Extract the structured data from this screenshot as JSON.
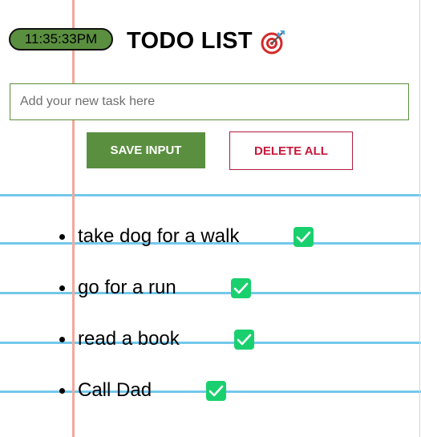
{
  "header": {
    "clock_time": "11:35:33PM",
    "title": "TODO LIST",
    "title_icon": "target-icon"
  },
  "input": {
    "placeholder": "Add your new task here",
    "value": ""
  },
  "buttons": {
    "save_label": "SAVE INPUT",
    "delete_all_label": "DELETE ALL"
  },
  "tasks": [
    {
      "text": "take dog for a walk",
      "icon": "check-icon"
    },
    {
      "text": "go for a run",
      "icon": "check-icon"
    },
    {
      "text": "read a book",
      "icon": "check-icon"
    },
    {
      "text": "Call Dad",
      "icon": "check-icon"
    }
  ],
  "colors": {
    "accent_green": "#5a8f3f",
    "danger_red": "#c8193c",
    "check_green": "#1ad06e",
    "ruled_line_blue": "#72c8ea",
    "margin_line_pink": "#f0a89a"
  }
}
